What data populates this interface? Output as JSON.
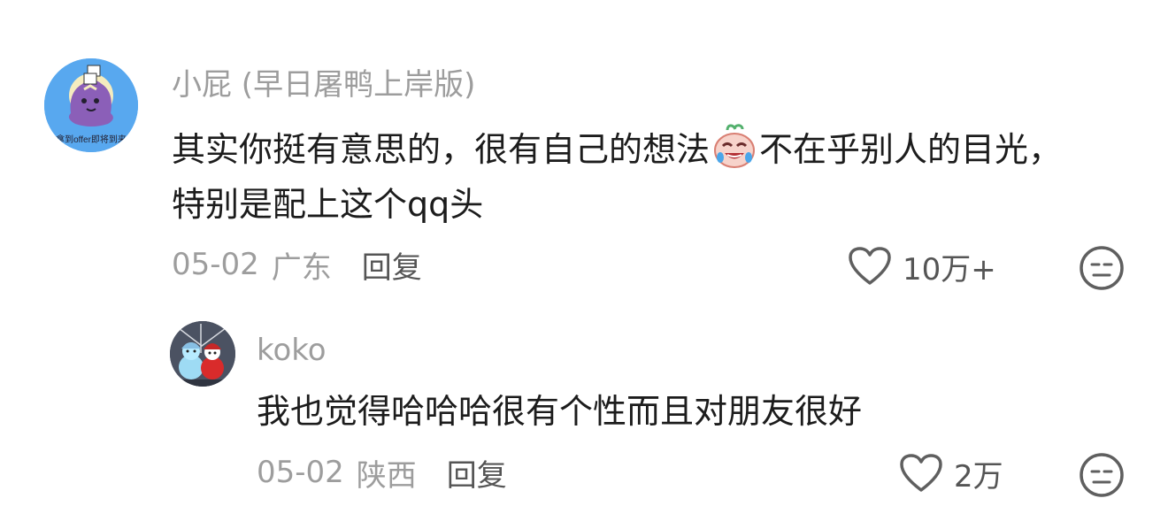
{
  "comment": {
    "username": "小屁 (早日屠鸭上岸版)",
    "text_before_emoji": "其实你挺有意思的，很有自己的想法",
    "text_after_emoji": "不在乎别人的目光，特别是配上这个qq头",
    "avatar_text": "拿到offer即将到来",
    "date": "05-02",
    "location": "广东",
    "reply_label": "回复",
    "likes": "10万+",
    "emoji_icon": "crying-laughing-emoji",
    "colors": {
      "username": "#9d9d9d",
      "content": "#1c1c1c",
      "meta": "#9d9d9d",
      "action": "#555555",
      "avatar_bg": "#58a8ef"
    }
  },
  "reply": {
    "username": "koko",
    "text": "我也觉得哈哈哈很有个性而且对朋友很好",
    "date": "05-02",
    "location": "陕西",
    "reply_label": "回复",
    "likes": "2万",
    "avatar_icon": "snowman-dolls-photo"
  },
  "icons": {
    "like": "heart-outline-icon",
    "dislike": "unamused-face-icon"
  }
}
